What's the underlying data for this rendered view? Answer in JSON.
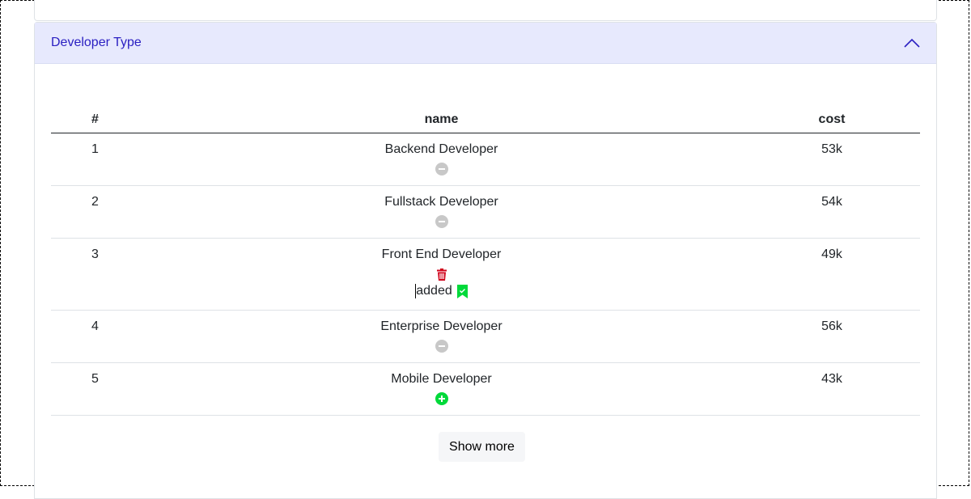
{
  "accordion": {
    "title": "Developer Type"
  },
  "table": {
    "headers": {
      "num": "#",
      "name": "name",
      "cost": "cost"
    },
    "rows": [
      {
        "num": "1",
        "name": "Backend Developer",
        "cost": "53k",
        "action_icon": "minus-circle-icon"
      },
      {
        "num": "2",
        "name": "Fullstack Developer",
        "cost": "54k",
        "action_icon": "minus-circle-icon"
      },
      {
        "num": "3",
        "name": "Front End Developer",
        "cost": "49k",
        "action_icon": "trash-icon",
        "status": "added",
        "status_icon": "bookmark-check-icon"
      },
      {
        "num": "4",
        "name": "Enterprise Developer",
        "cost": "56k",
        "action_icon": "minus-circle-icon"
      },
      {
        "num": "5",
        "name": "Mobile Developer",
        "cost": "43k",
        "action_icon": "plus-circle-icon"
      }
    ]
  },
  "show_more_label": "Show more",
  "colors": {
    "header_bg": "#e7e9fd",
    "header_text": "#2b20c2",
    "minus_icon": "#c8c8c8",
    "trash_icon": "#d0021b",
    "plus_icon": "#00d93a"
  }
}
